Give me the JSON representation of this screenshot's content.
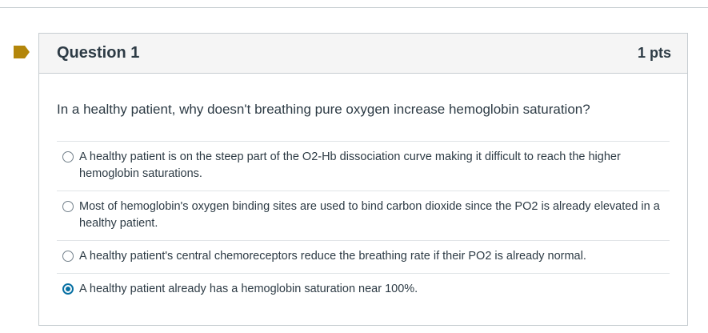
{
  "question": {
    "title": "Question 1",
    "points": "1 pts",
    "text": "In a healthy patient, why doesn't breathing pure oxygen increase hemoglobin saturation?",
    "answers": [
      {
        "label": "A healthy patient is on the steep part of the O2-Hb dissociation curve making it difficult to reach the higher hemoglobin saturations.",
        "selected": false
      },
      {
        "label": "Most of hemoglobin's oxygen binding sites are used to bind carbon dioxide since the PO2 is already elevated in a healthy patient.",
        "selected": false
      },
      {
        "label": "A healthy patient's central chemoreceptors reduce the breathing rate if their PO2 is already normal.",
        "selected": false
      },
      {
        "label": "A healthy patient already has a hemoglobin saturation near 100%.",
        "selected": true
      }
    ]
  },
  "colors": {
    "flag": "#b3860b",
    "accent": "#0770a3",
    "header_bg": "#f5f5f5",
    "border": "#c7cdd1"
  },
  "icons": {
    "flag": "bookmark-flag-icon"
  }
}
